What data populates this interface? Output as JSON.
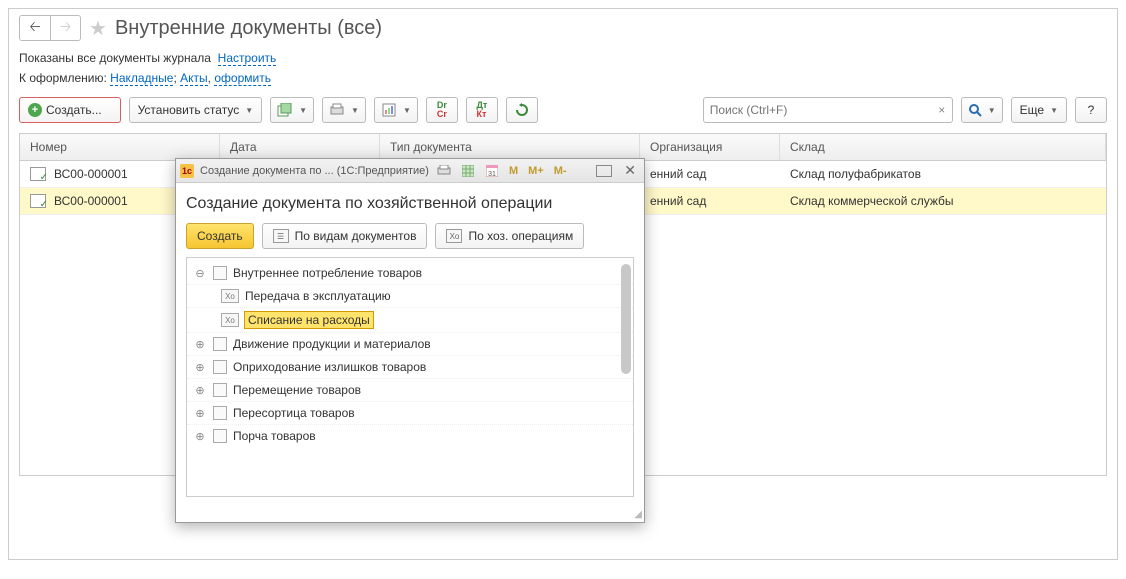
{
  "header": {
    "title": "Внутренние документы (все)"
  },
  "info": {
    "shown_prefix": "Показаны все документы журнала",
    "configure": "Настроить",
    "todo_prefix": "К оформлению:",
    "link_nakladnye": "Накладные",
    "link_akty": "Акты",
    "link_oformit": "оформить"
  },
  "toolbar": {
    "create": "Создать...",
    "set_status": "Установить статус",
    "search_placeholder": "Поиск (Ctrl+F)",
    "more": "Еще"
  },
  "table": {
    "cols": {
      "num": "Номер",
      "date": "Дата",
      "type": "Тип документа",
      "org": "Организация",
      "wh": "Склад"
    },
    "rows": [
      {
        "num": "ВС00-000001",
        "org": "енний сад",
        "wh": "Склад полуфабрикатов"
      },
      {
        "num": "ВС00-000001",
        "org": "енний сад",
        "wh": "Склад коммерческой службы"
      }
    ]
  },
  "dialog": {
    "wintitle": "Создание документа по ...  (1С:Предприятие)",
    "heading": "Создание документа по хозяйственной операции",
    "btn_create": "Создать",
    "btn_by_doc": "По видам документов",
    "btn_by_op": "По хоз. операциям",
    "m": "M",
    "mplus": "M+",
    "mminus": "M-",
    "tree": [
      {
        "lvl": 0,
        "exp": "⊖",
        "label": "Внутреннее потребление товаров"
      },
      {
        "lvl": 1,
        "label": "Передача в эксплуатацию"
      },
      {
        "lvl": 1,
        "label": "Списание на расходы",
        "selected": true
      },
      {
        "lvl": 0,
        "exp": "⊕",
        "label": "Движение продукции и материалов"
      },
      {
        "lvl": 0,
        "exp": "⊕",
        "label": "Оприходование излишков товаров"
      },
      {
        "lvl": 0,
        "exp": "⊕",
        "label": "Перемещение товаров"
      },
      {
        "lvl": 0,
        "exp": "⊕",
        "label": "Пересортица товаров"
      },
      {
        "lvl": 0,
        "exp": "⊕",
        "label": "Порча товаров"
      }
    ]
  }
}
